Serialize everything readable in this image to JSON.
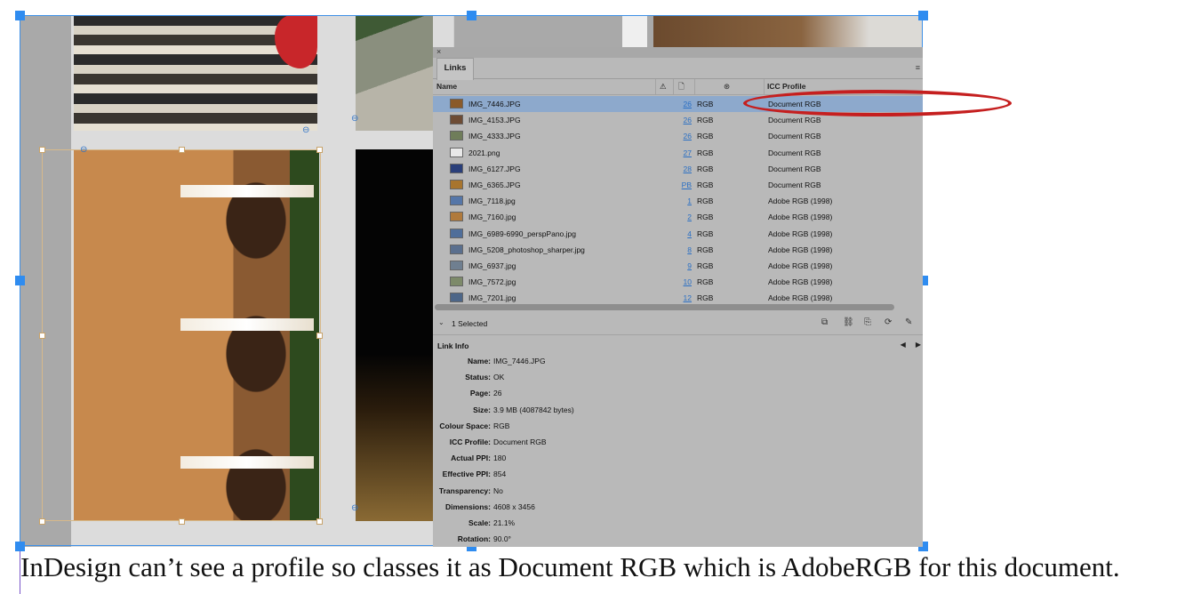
{
  "panel": {
    "close": "×",
    "tab": "Links",
    "menu": "≡",
    "columns": {
      "name": "Name",
      "warn": "⚠",
      "page": "🗋",
      "color": "⊛",
      "icc": "ICC Profile"
    }
  },
  "links": [
    {
      "name": "IMG_7446.JPG",
      "page": "26",
      "cs": "RGB",
      "icc": "Document RGB",
      "selected": true,
      "thumb": "#8a5a2a"
    },
    {
      "name": "IMG_4153.JPG",
      "page": "26",
      "cs": "RGB",
      "icc": "Document RGB",
      "thumb": "#6d4c35"
    },
    {
      "name": "IMG_4333.JPG",
      "page": "26",
      "cs": "RGB",
      "icc": "Document RGB",
      "thumb": "#6f7d5a"
    },
    {
      "name": "2021.png",
      "page": "27",
      "cs": "RGB",
      "icc": "Document RGB",
      "thumb": "#e9e9e9"
    },
    {
      "name": "IMG_6127.JPG",
      "page": "28",
      "cs": "RGB",
      "icc": "Document RGB",
      "thumb": "#2a3f7a"
    },
    {
      "name": "IMG_6365.JPG",
      "page": "PB",
      "cs": "RGB",
      "icc": "Document RGB",
      "thumb": "#a8752e"
    },
    {
      "name": "IMG_7118.jpg",
      "page": "1",
      "cs": "RGB",
      "icc": "Adobe RGB (1998)",
      "thumb": "#5576a8"
    },
    {
      "name": "IMG_7160.jpg",
      "page": "2",
      "cs": "RGB",
      "icc": "Adobe RGB (1998)",
      "thumb": "#b07a3c"
    },
    {
      "name": "IMG_6989-6990_perspPano.jpg",
      "page": "4",
      "cs": "RGB",
      "icc": "Adobe RGB (1998)",
      "thumb": "#4f6e9a"
    },
    {
      "name": "IMG_5208_photoshop_sharper.jpg",
      "page": "8",
      "cs": "RGB",
      "icc": "Adobe RGB (1998)",
      "thumb": "#5a6f8e"
    },
    {
      "name": "IMG_6937.jpg",
      "page": "9",
      "cs": "RGB",
      "icc": "Adobe RGB (1998)",
      "thumb": "#6f7f90"
    },
    {
      "name": "IMG_7572.jpg",
      "page": "10",
      "cs": "RGB",
      "icc": "Adobe RGB (1998)",
      "thumb": "#7d8a6a"
    },
    {
      "name": "IMG_7201.jpg",
      "page": "12",
      "cs": "RGB",
      "icc": "Adobe RGB (1998)",
      "thumb": "#4d6688"
    }
  ],
  "selection": {
    "chevron": "⌄",
    "text": "1 Selected"
  },
  "tools": [
    "⧉",
    "⛓",
    "⎘",
    "⟳",
    "✎"
  ],
  "info": {
    "title": "Link Info",
    "nav_prev": "◀",
    "nav_next": "▶",
    "fields": [
      {
        "key": "Name:",
        "value": "IMG_7446.JPG"
      },
      {
        "key": "Status:",
        "value": "OK"
      },
      {
        "key": "Page:",
        "value": "26"
      },
      {
        "key": "Size:",
        "value": "3.9 MB (4087842 bytes)"
      },
      {
        "key": "Colour Space:",
        "value": "RGB"
      },
      {
        "key": "ICC Profile:",
        "value": "Document RGB"
      },
      {
        "key": "Actual PPI:",
        "value": "180"
      },
      {
        "key": "Effective PPI:",
        "value": "854"
      },
      {
        "key": "Transparency:",
        "value": "No"
      },
      {
        "key": "Dimensions:",
        "value": "4608 x 3456"
      },
      {
        "key": "Scale:",
        "value": "21.1%"
      },
      {
        "key": "Rotation:",
        "value": "90.0°"
      }
    ]
  },
  "caption": "InDesign can’t see a profile so classes it as Document RGB which is AdobeRGB for this document.",
  "link_badge": "⊖",
  "colors": {
    "selected_row": "#8da9cc",
    "annotation": "#c51f1f",
    "frame": "#3d8fe6"
  }
}
